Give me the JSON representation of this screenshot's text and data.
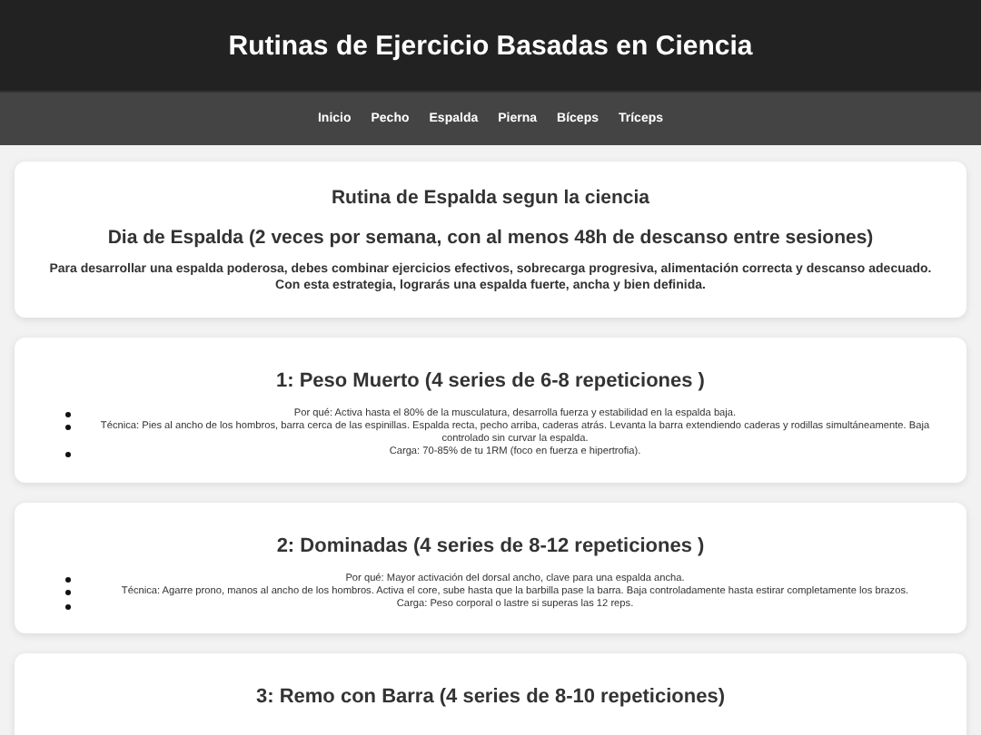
{
  "header": {
    "title": "Rutinas de Ejercicio Basadas en Ciencia"
  },
  "nav": [
    {
      "label": "Inicio"
    },
    {
      "label": "Pecho"
    },
    {
      "label": "Espalda"
    },
    {
      "label": "Pierna"
    },
    {
      "label": "Bíceps"
    },
    {
      "label": "Tríceps"
    }
  ],
  "intro": {
    "title": "Rutina de Espalda segun la ciencia",
    "subtitle": "Dia de Espalda (2 veces por semana, con al menos 48h de descanso entre sesiones)",
    "text": "Para desarrollar una espalda poderosa, debes combinar ejercicios efectivos, sobrecarga progresiva, alimentación correcta y descanso adecuado. Con esta estrategia, lograrás una espalda fuerte, ancha y bien definida."
  },
  "exercises": [
    {
      "title": "1: Peso Muerto (4 series de 6-8 repeticiones )",
      "items": [
        "Por qué: Activa hasta el 80% de la musculatura, desarrolla fuerza y estabilidad en la espalda baja.",
        "Técnica: Pies al ancho de los hombros, barra cerca de las espinillas. Espalda recta, pecho arriba, caderas atrás. Levanta la barra extendiendo caderas y rodillas simultáneamente. Baja controlado sin curvar la espalda.",
        "Carga: 70-85% de tu 1RM (foco en fuerza e hipertrofia)."
      ]
    },
    {
      "title": "2: Dominadas (4 series de 8-12 repeticiones )",
      "items": [
        "Por qué: Mayor activación del dorsal ancho, clave para una espalda ancha.",
        "Técnica: Agarre prono, manos al ancho de los hombros. Activa el core, sube hasta que la barbilla pase la barra. Baja controladamente hasta estirar completamente los brazos.",
        "Carga: Peso corporal o lastre si superas las 12 reps."
      ]
    },
    {
      "title": "3: Remo con Barra (4 series de 8-10 repeticiones)"
    }
  ]
}
